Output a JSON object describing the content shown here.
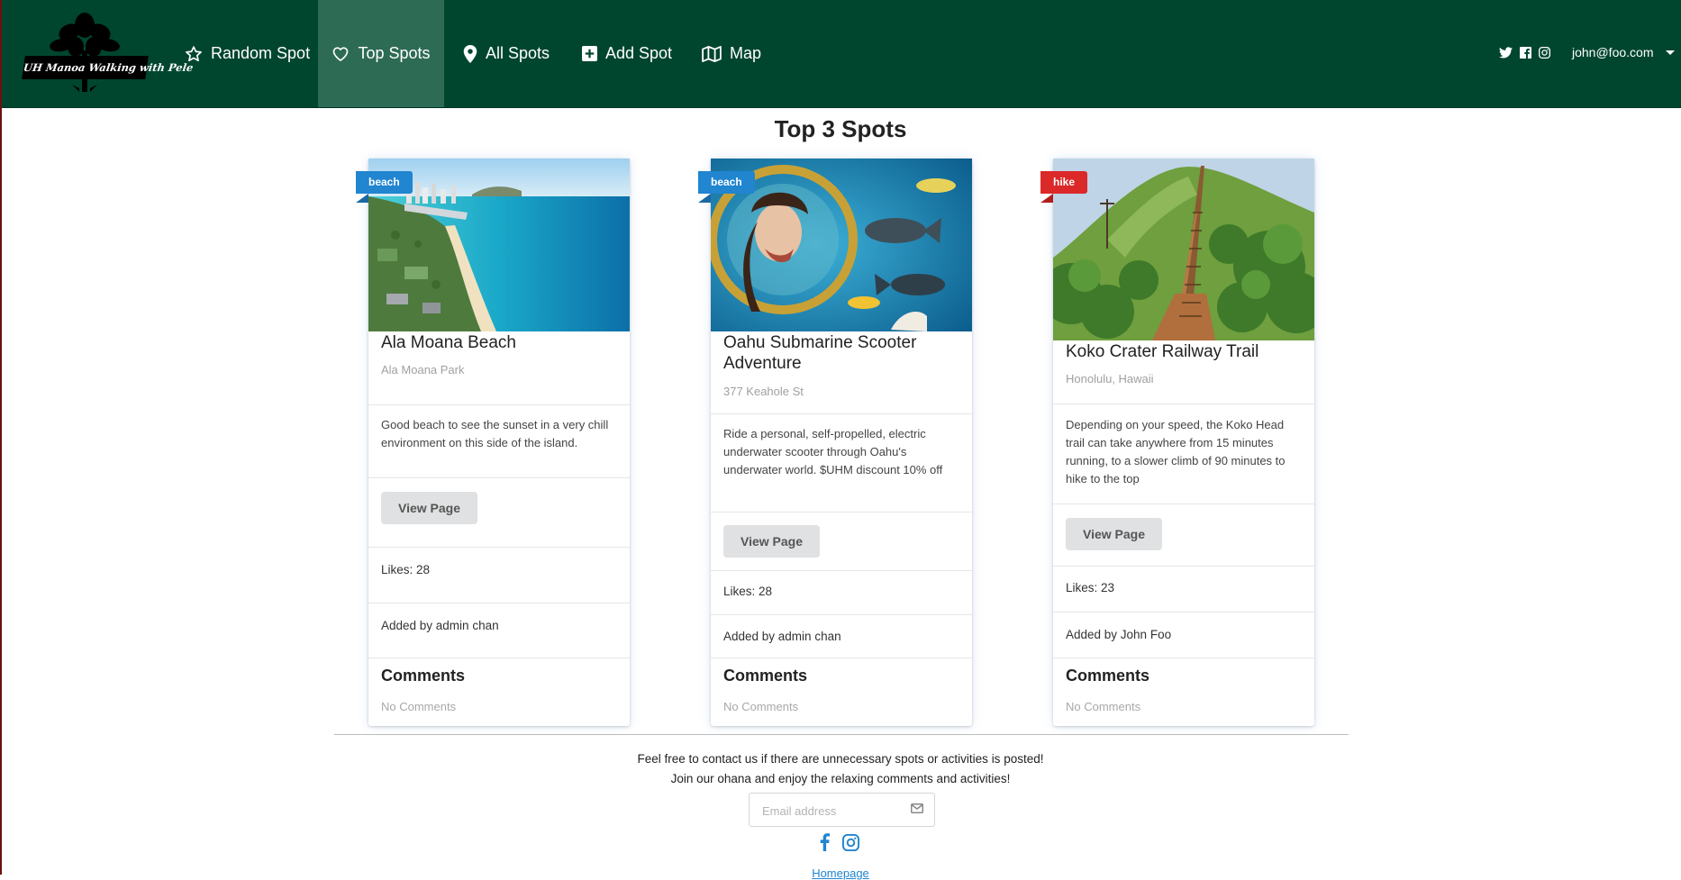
{
  "brand": {
    "logo_text": "UH Manoa Walking with Pele"
  },
  "nav": {
    "items": [
      {
        "label": "Random Spot",
        "icon": "star-icon"
      },
      {
        "label": "Top Spots",
        "icon": "heart-icon",
        "active": true
      },
      {
        "label": "All Spots",
        "icon": "map-pin-icon"
      },
      {
        "label": "Add Spot",
        "icon": "plus-square-icon"
      },
      {
        "label": "Map",
        "icon": "map-icon"
      }
    ],
    "social_icons": [
      "twitter-icon",
      "facebook-icon",
      "instagram-icon"
    ],
    "user_email": "john@foo.com"
  },
  "page": {
    "title": "Top 3 Spots"
  },
  "cards": [
    {
      "tag": "beach",
      "title": "Ala Moana Beach",
      "location": "Ala Moana Park",
      "description": "Good beach to see the sunset in a very chill environment on this side of the island.",
      "button": "View Page",
      "likes": "Likes: 28",
      "added_by": "Added by admin chan",
      "comments_header": "Comments",
      "comments_empty": "No Comments"
    },
    {
      "tag": "beach",
      "title": "Oahu Submarine Scooter Adventure",
      "location": "377 Keahole St",
      "description": "Ride a personal, self-propelled, electric underwater scooter through Oahu's underwater world. $UHM discount 10% off",
      "button": "View Page",
      "likes": "Likes: 28",
      "added_by": "Added by admin chan",
      "comments_header": "Comments",
      "comments_empty": "No Comments"
    },
    {
      "tag": "hike",
      "title": "Koko Crater Railway Trail",
      "location": "Honolulu, Hawaii",
      "description": "Depending on your speed, the Koko Head trail can take anywhere from 15 minutes running, to a slower climb of 90 minutes to hike to the top",
      "button": "View Page",
      "likes": "Likes: 23",
      "added_by": "Added by John Foo",
      "comments_header": "Comments",
      "comments_empty": "No Comments"
    }
  ],
  "footer": {
    "line1": "Feel free to contact us if there are unnecessary spots or activities is posted!",
    "line2": "Join our ohana and enjoy the relaxing comments and activities!",
    "email_placeholder": "Email address",
    "social_icons": [
      "facebook-icon",
      "instagram-icon"
    ],
    "link": "Homepage"
  },
  "colors": {
    "nav_bg": "#00462f",
    "nav_active": "#2d6b55",
    "tag_beach": "#2185d0",
    "tag_hike": "#db2828",
    "link": "#2185d0"
  }
}
